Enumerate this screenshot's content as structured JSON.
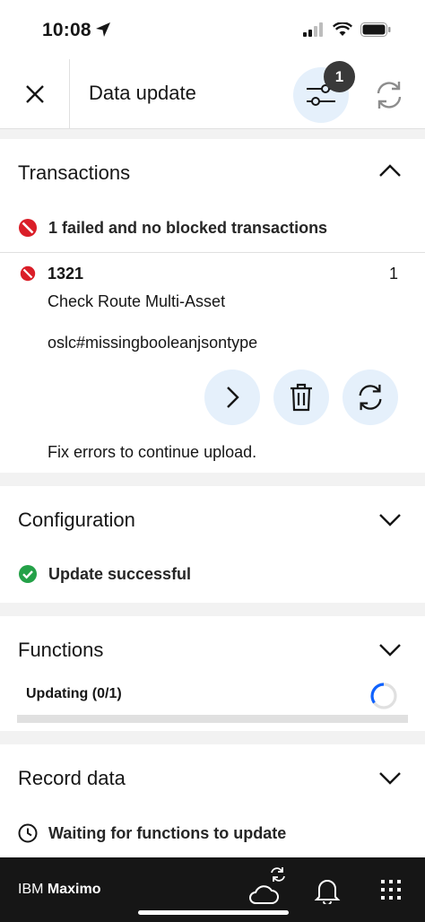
{
  "status_bar": {
    "time": "10:08"
  },
  "header": {
    "title": "Data update",
    "filter_badge_count": "1"
  },
  "transactions": {
    "title": "Transactions",
    "summary": "1 failed and no blocked transactions",
    "item": {
      "id": "1321",
      "count": "1",
      "name": "Check Route Multi-Asset",
      "error": "oslc#missingbooleanjsontype"
    },
    "footer_note": "Fix errors to continue upload."
  },
  "configuration": {
    "title": "Configuration",
    "status": "Update successful"
  },
  "functions": {
    "title": "Functions",
    "status": "Updating (0/1)",
    "progress": 0
  },
  "record_data": {
    "title": "Record data",
    "status": "Waiting for functions to update"
  },
  "bottom_bar": {
    "brand_prefix": "IBM",
    "brand_name": "Maximo"
  },
  "colors": {
    "error": "#da1e28",
    "success": "#24a148",
    "accent_bg": "#e5f0fb",
    "spinner": "#0f62fe"
  },
  "icons": [
    "close-icon",
    "filter-icon",
    "sync-icon",
    "chevron-up-icon",
    "chevron-down-icon",
    "error-icon",
    "chevron-right-icon",
    "trash-icon",
    "success-icon",
    "spinner-icon",
    "clock-icon",
    "cloud-sync-icon",
    "bell-icon",
    "app-grid-icon"
  ]
}
